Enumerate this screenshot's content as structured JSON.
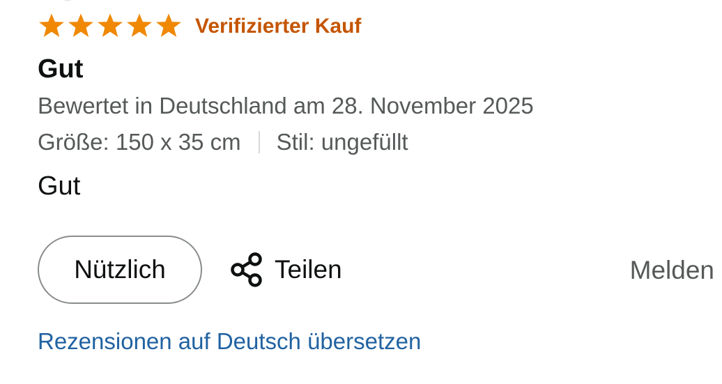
{
  "review": {
    "rating": 5,
    "rating_max": 5,
    "star_color": "#f3a847",
    "star_fill_color": "#f08804",
    "verified_label": "Verifizierter Kauf",
    "verified_color": "#c45500",
    "title": "Gut",
    "date_text": "Bewertet in Deutschland am 28. November 2025",
    "variant": {
      "size": "Größe: 150 x 35 cm",
      "style": "Stil: ungefüllt"
    },
    "body": "Gut"
  },
  "actions": {
    "helpful_label": "Nützlich",
    "share_label": "Teilen",
    "share_icon": "share-icon",
    "report_label": "Melden"
  },
  "translate": {
    "link_text": "Rezensionen auf Deutsch übersetzen",
    "link_color": "#2162a1"
  }
}
